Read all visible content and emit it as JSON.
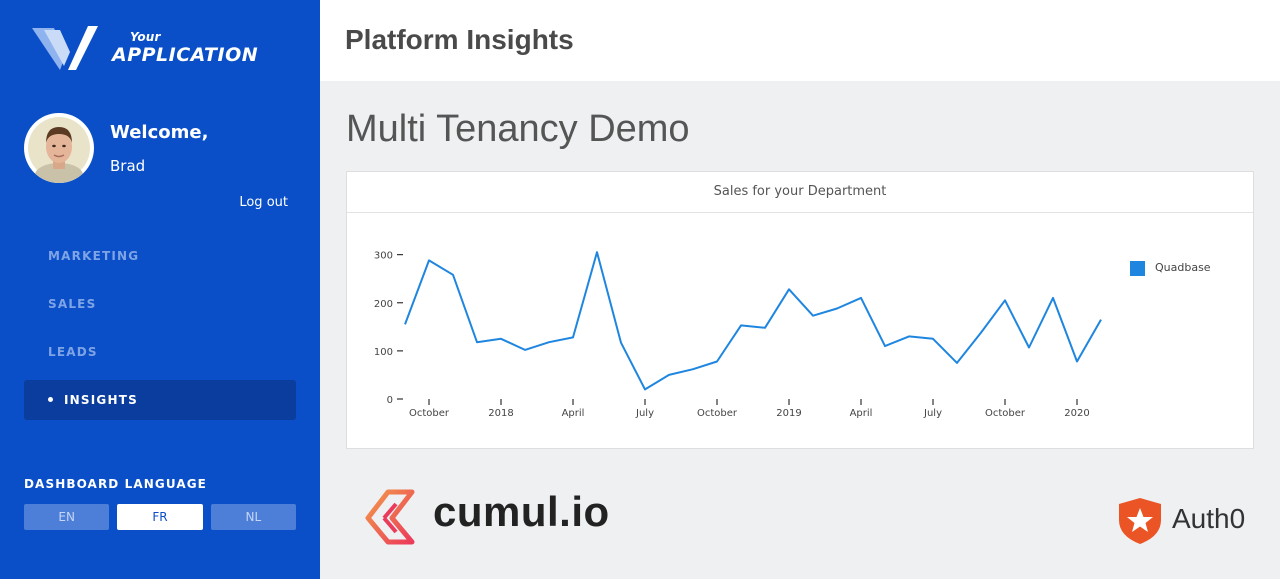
{
  "brand": {
    "small": "Your",
    "big": "APPLICATION"
  },
  "user": {
    "welcome": "Welcome,",
    "name": "Brad",
    "logout": "Log out"
  },
  "nav": {
    "items": [
      {
        "label": "MARKETING",
        "active": false
      },
      {
        "label": "SALES",
        "active": false
      },
      {
        "label": "LEADS",
        "active": false
      },
      {
        "label": "INSIGHTS",
        "active": true
      }
    ]
  },
  "language": {
    "title": "DASHBOARD LANGUAGE",
    "options": [
      "EN",
      "FR",
      "NL"
    ],
    "selected": "FR"
  },
  "header": {
    "title": "Platform Insights"
  },
  "main": {
    "title": "Multi Tenancy Demo"
  },
  "chart_data": {
    "type": "line",
    "title": "Sales for your Department",
    "xlabel": "",
    "ylabel": "",
    "ylim": [
      0,
      320
    ],
    "yticks": [
      0,
      100,
      200,
      300
    ],
    "xtick_labels": [
      {
        "label": "October",
        "idx": 1
      },
      {
        "label": "2018",
        "idx": 4
      },
      {
        "label": "April",
        "idx": 7
      },
      {
        "label": "July",
        "idx": 10
      },
      {
        "label": "October",
        "idx": 13
      },
      {
        "label": "2019",
        "idx": 16
      },
      {
        "label": "April",
        "idx": 19
      },
      {
        "label": "July",
        "idx": 22
      },
      {
        "label": "October",
        "idx": 25
      },
      {
        "label": "2020",
        "idx": 28
      }
    ],
    "x": [
      "2017-09",
      "2017-10",
      "2017-11",
      "2017-12",
      "2018-01",
      "2018-02",
      "2018-03",
      "2018-04",
      "2018-05",
      "2018-06",
      "2018-07",
      "2018-08",
      "2018-09",
      "2018-10",
      "2018-11",
      "2018-12",
      "2019-01",
      "2019-02",
      "2019-03",
      "2019-04",
      "2019-05",
      "2019-06",
      "2019-07",
      "2019-08",
      "2019-09",
      "2019-10",
      "2019-11",
      "2019-12",
      "2020-01",
      "2020-02"
    ],
    "series": [
      {
        "name": "Quadbase",
        "color": "#1f86e0",
        "values": [
          155,
          288,
          258,
          118,
          125,
          102,
          118,
          128,
          305,
          117,
          20,
          50,
          62,
          78,
          153,
          148,
          228,
          173,
          188,
          210,
          110,
          130,
          125,
          75,
          138,
          205,
          107,
          210,
          78,
          165
        ]
      }
    ],
    "legend": "right",
    "grid": false
  }
}
